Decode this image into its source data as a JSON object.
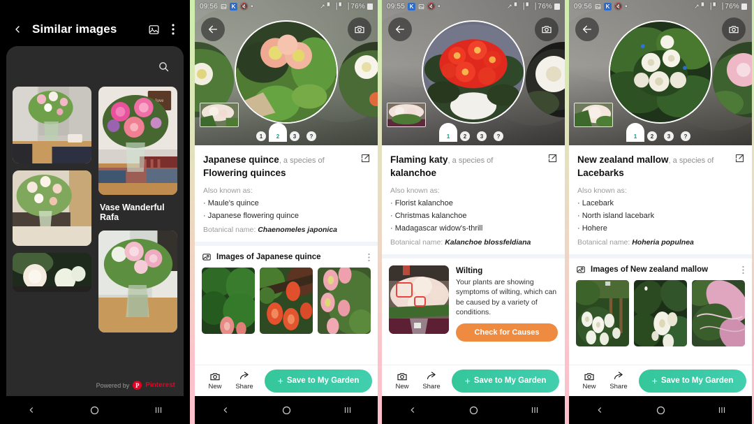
{
  "panel1": {
    "header": {
      "title": "Similar images",
      "back_icon": "chevron-left-icon",
      "gallery_icon": "image-icon",
      "overflow_icon": "kebab-menu-icon"
    },
    "search_icon": "search-icon",
    "results": [
      {
        "caption": ""
      },
      {
        "caption": "Vase Wanderful Rafa"
      },
      {
        "caption": ""
      },
      {
        "caption": ""
      },
      {
        "caption": ""
      }
    ],
    "caption": "Vase Wanderful Rafa",
    "powered_by": "Powered by",
    "brand": "Pinterest",
    "brand_initial": "P",
    "nav": {
      "back": "back-icon",
      "home": "home-icon",
      "recents": "recents-icon"
    }
  },
  "panel2": {
    "status": {
      "time": "09:56",
      "battery": "76%",
      "wifi_icon": "wifi-icon",
      "signal_icon": "signal-icon",
      "k_badge": "K"
    },
    "hero": {
      "back_icon": "back-arrow-icon",
      "camera_icon": "camera-icon"
    },
    "pager": {
      "dots": [
        "1",
        "2",
        "3",
        "?"
      ],
      "active": 1
    },
    "plant": {
      "name": "Japanese quince",
      "species_of": ", a species of",
      "genus": "Flowering quinces",
      "aka_label": "Also known as:",
      "aka": [
        "Maule's quince",
        "Japanese flowering quince"
      ],
      "botanical_label": "Botanical name:",
      "botanical_name": "Chaenomeles japonica",
      "edit_icon": "edit-icon"
    },
    "images_section": {
      "icon": "image-stack-icon",
      "title": "Images of Japanese quince",
      "overflow_icon": "kebab-menu-icon"
    },
    "actions": {
      "new_label": "New",
      "new_icon": "camera-icon",
      "share_label": "Share",
      "share_icon": "share-icon",
      "save_label": "Save to My Garden",
      "save_plus": "+"
    }
  },
  "panel3": {
    "status": {
      "time": "09:55",
      "battery": "76%",
      "wifi_icon": "wifi-icon",
      "signal_icon": "signal-icon",
      "k_badge": "K"
    },
    "hero": {
      "back_icon": "back-arrow-icon",
      "camera_icon": "camera-icon"
    },
    "pager": {
      "dots": [
        "1",
        "2",
        "3",
        "?"
      ],
      "active": 0
    },
    "plant": {
      "name": "Flaming katy",
      "species_of": ", a species of",
      "genus": "kalanchoe",
      "aka_label": "Also known as:",
      "aka": [
        "Florist kalanchoe",
        "Christmas kalanchoe",
        "Madagascar widow's-thrill"
      ],
      "botanical_label": "Botanical name:",
      "botanical_name": "Kalanchoe blossfeldiana",
      "edit_icon": "edit-icon"
    },
    "diagnosis": {
      "title": "Wilting",
      "text": "Your plants are showing symptoms of wilting, which can be caused by a variety of conditions.",
      "button": "Check for Causes"
    },
    "actions": {
      "new_label": "New",
      "new_icon": "camera-icon",
      "share_label": "Share",
      "share_icon": "share-icon",
      "save_label": "Save to My Garden",
      "save_plus": "+"
    }
  },
  "panel4": {
    "status": {
      "time": "09:56",
      "battery": "76%",
      "wifi_icon": "wifi-icon",
      "signal_icon": "signal-icon",
      "k_badge": "K"
    },
    "hero": {
      "back_icon": "back-arrow-icon",
      "camera_icon": "camera-icon"
    },
    "pager": {
      "dots": [
        "1",
        "2",
        "3",
        "?"
      ],
      "active": 0
    },
    "plant": {
      "name": "New zealand mallow",
      "species_of": ", a species of",
      "genus": "Lacebarks",
      "aka_label": "Also known as:",
      "aka": [
        "Lacebark",
        "North island lacebark",
        "Hohere"
      ],
      "botanical_label": "Botanical name:",
      "botanical_name": "Hoheria populnea",
      "edit_icon": "edit-icon"
    },
    "images_section": {
      "icon": "image-stack-icon",
      "title": "Images of New zealand mallow",
      "overflow_icon": "kebab-menu-icon"
    },
    "actions": {
      "new_label": "New",
      "new_icon": "camera-icon",
      "share_label": "Share",
      "share_icon": "share-icon",
      "save_label": "Save to My Garden",
      "save_plus": "+"
    }
  },
  "theme": {
    "accent_green": "#3ac9a6",
    "accent_orange": "#ef8b41",
    "pinterest_red": "#e60023",
    "dark_bg": "#000000",
    "sheet_bg": "#2b2b2b"
  }
}
